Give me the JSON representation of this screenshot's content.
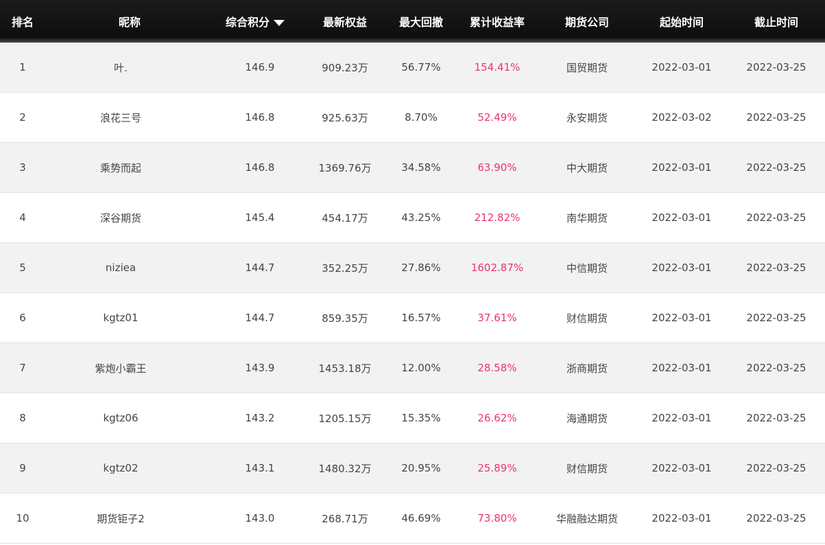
{
  "columns": [
    "排名",
    "昵称",
    "综合积分",
    "最新权益",
    "最大回撤",
    "累计收益率",
    "期货公司",
    "起始时间",
    "截止时间"
  ],
  "accent_pink": "#e8337a",
  "rows": [
    {
      "rank": "1",
      "nickname": "叶.",
      "score": "146.9",
      "equity": "909.23万",
      "drawdown": "56.77%",
      "return": "154.41%",
      "company": "国贸期货",
      "start": "2022-03-01",
      "end": "2022-03-25"
    },
    {
      "rank": "2",
      "nickname": "浪花三号",
      "score": "146.8",
      "equity": "925.63万",
      "drawdown": "8.70%",
      "return": "52.49%",
      "company": "永安期货",
      "start": "2022-03-02",
      "end": "2022-03-25"
    },
    {
      "rank": "3",
      "nickname": "乘势而起",
      "score": "146.8",
      "equity": "1369.76万",
      "drawdown": "34.58%",
      "return": "63.90%",
      "company": "中大期货",
      "start": "2022-03-01",
      "end": "2022-03-25"
    },
    {
      "rank": "4",
      "nickname": "深谷期货",
      "score": "145.4",
      "equity": "454.17万",
      "drawdown": "43.25%",
      "return": "212.82%",
      "company": "南华期货",
      "start": "2022-03-01",
      "end": "2022-03-25"
    },
    {
      "rank": "5",
      "nickname": "niziea",
      "score": "144.7",
      "equity": "352.25万",
      "drawdown": "27.86%",
      "return": "1602.87%",
      "company": "中信期货",
      "start": "2022-03-01",
      "end": "2022-03-25"
    },
    {
      "rank": "6",
      "nickname": "kgtz01",
      "score": "144.7",
      "equity": "859.35万",
      "drawdown": "16.57%",
      "return": "37.61%",
      "company": "财信期货",
      "start": "2022-03-01",
      "end": "2022-03-25"
    },
    {
      "rank": "7",
      "nickname": "紫炮小霸王",
      "score": "143.9",
      "equity": "1453.18万",
      "drawdown": "12.00%",
      "return": "28.58%",
      "company": "浙商期货",
      "start": "2022-03-01",
      "end": "2022-03-25"
    },
    {
      "rank": "8",
      "nickname": "kgtz06",
      "score": "143.2",
      "equity": "1205.15万",
      "drawdown": "15.35%",
      "return": "26.62%",
      "company": "海通期货",
      "start": "2022-03-01",
      "end": "2022-03-25"
    },
    {
      "rank": "9",
      "nickname": "kgtz02",
      "score": "143.1",
      "equity": "1480.32万",
      "drawdown": "20.95%",
      "return": "25.89%",
      "company": "财信期货",
      "start": "2022-03-01",
      "end": "2022-03-25"
    },
    {
      "rank": "10",
      "nickname": "期货钜子2",
      "score": "143.0",
      "equity": "268.71万",
      "drawdown": "46.69%",
      "return": "73.80%",
      "company": "华融融达期货",
      "start": "2022-03-01",
      "end": "2022-03-25"
    }
  ]
}
